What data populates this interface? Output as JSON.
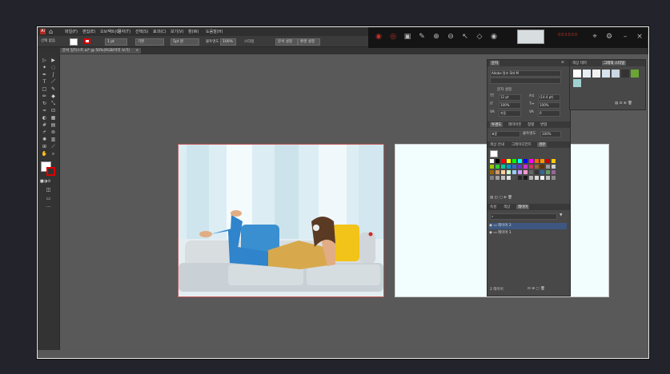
{
  "app": {
    "logo": "Ai",
    "home_icon": "home-icon"
  },
  "menus": [
    "파일(F)",
    "편집(E)",
    "오브젝트(O)",
    "문자(T)",
    "선택(S)",
    "효과(C)",
    "보기(V)",
    "창(W)",
    "도움말(H)"
  ],
  "menu_extra": "",
  "control": {
    "selection_label": "선택 없음",
    "stroke_weight": "1 pt",
    "brush_label": "기본",
    "stroke_style": "5pt 원",
    "opacity_label": "불투명도",
    "opacity_value": "100%",
    "style_label": "스타일",
    "doc_setup": "문서 설정",
    "prefs": "환경 설정"
  },
  "document_tab": "문서 일러스트.ai* @ 50%(RGB/미리 보기)",
  "float_toolbar": {
    "icons": [
      "record-icon",
      "stop-icon",
      "screenshot-icon",
      "pen-icon",
      "zoom-in-icon",
      "zoom-out-icon",
      "pointer-icon",
      "fill-icon",
      "eye-icon"
    ],
    "preview_label": "",
    "right_icons": [
      "mic-icon",
      "settings-icon"
    ],
    "counter": "000000"
  },
  "panel_main": {
    "tabs": [
      "문자"
    ],
    "font_name": "Adobe 명조 Std M",
    "font_style": "",
    "char_set_label": "문자 설정",
    "font_size": "12 pt",
    "leading": "(14.4 pt)",
    "h_scale": "100%",
    "v_scale": "100%",
    "tracking": "0",
    "kerning": "자동",
    "para_tabs": [
      "투명도",
      "레이아웃",
      "정렬",
      "변형"
    ],
    "blend_mode": "표준",
    "opacity_label": "불투명도",
    "opacity_value": "100%",
    "swatch_tabs": [
      "색상 안내",
      "그레이디언트",
      "견본"
    ],
    "layer_tabs": [
      "속성",
      "색상",
      "레이어"
    ],
    "search_placeholder": "",
    "layers": [
      {
        "name": "레이어 2",
        "selected": true
      },
      {
        "name": "레이어 1",
        "selected": false
      }
    ],
    "layer_count": "2 레이어"
  },
  "panel_side": {
    "tabs": [
      "색상 테마",
      "그래픽 스타일"
    ],
    "active": 1
  },
  "colors": {
    "accent": "#3d5780",
    "artboard_border": "#c45a5a",
    "recorder_red": "#c0302a"
  },
  "swatches": [
    "#ffffff",
    "#000000",
    "#ff0000",
    "#ffff00",
    "#00ff00",
    "#00ffff",
    "#0000ff",
    "#ff00ff",
    "#ff6600",
    "#ff9900",
    "#cc0000",
    "#ffcc00",
    "#99cc00",
    "#33cc33",
    "#00cc99",
    "#0099cc",
    "#3366cc",
    "#6633cc",
    "#cc33cc",
    "#cc3366",
    "#996633",
    "#663300",
    "#999999",
    "#cccccc",
    "#996600",
    "#cc9966",
    "#ffcc99",
    "#ccffcc",
    "#99ccff",
    "#cc99ff",
    "#ff99cc",
    "#666666",
    "#333333",
    "#336699",
    "#669966",
    "#996699",
    "#808080",
    "#a0a0a0",
    "#c0c0c0",
    "#e0e0e0",
    "#4d4d4d",
    "#262626",
    "#1a1a1a",
    "#b3b3b3",
    "#d9d9d9",
    "#f2f2f2",
    "#bfbfbf",
    "#8c8c8c"
  ]
}
